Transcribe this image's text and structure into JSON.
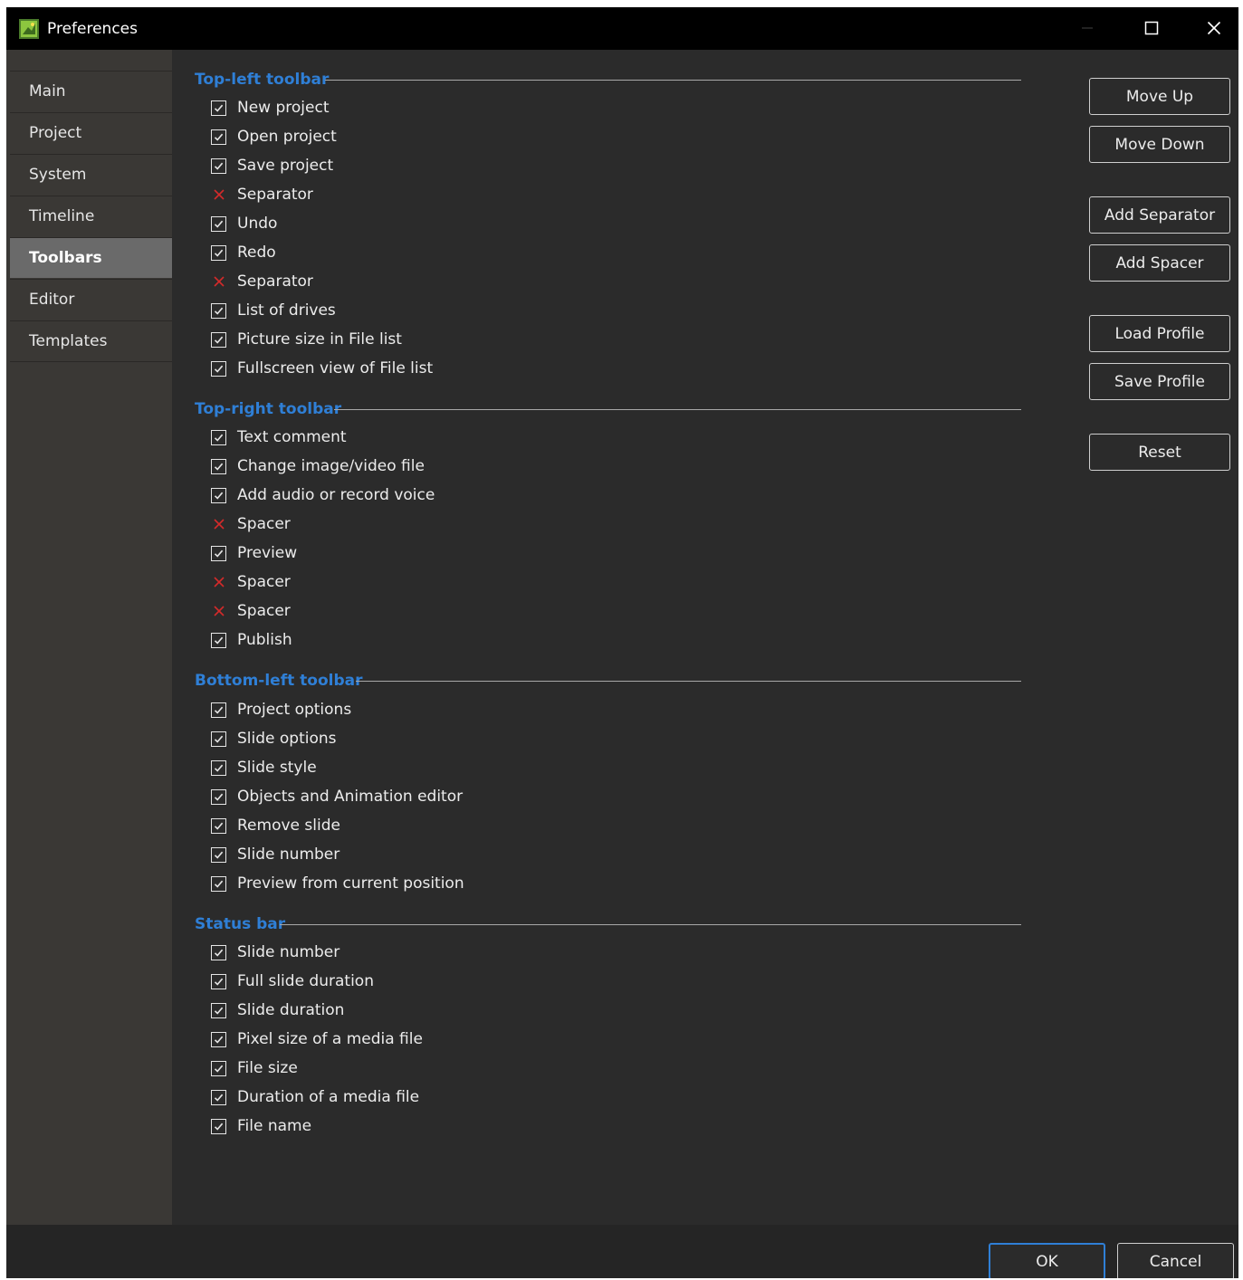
{
  "window": {
    "title": "Preferences",
    "accent_color": "#2f7fd6"
  },
  "sidebar": {
    "items": [
      {
        "label": "Main"
      },
      {
        "label": "Project"
      },
      {
        "label": "System"
      },
      {
        "label": "Timeline"
      },
      {
        "label": "Toolbars",
        "active": true
      },
      {
        "label": "Editor"
      },
      {
        "label": "Templates"
      }
    ]
  },
  "sections": [
    {
      "title": "Top-left toolbar",
      "items": [
        {
          "label": "New project",
          "state": "checked"
        },
        {
          "label": "Open project",
          "state": "checked"
        },
        {
          "label": "Save project",
          "state": "checked"
        },
        {
          "label": "Separator",
          "state": "x"
        },
        {
          "label": "Undo",
          "state": "checked"
        },
        {
          "label": "Redo",
          "state": "checked"
        },
        {
          "label": "Separator",
          "state": "x"
        },
        {
          "label": "List of drives",
          "state": "checked"
        },
        {
          "label": "Picture size in File list",
          "state": "checked"
        },
        {
          "label": "Fullscreen view of File list",
          "state": "checked"
        }
      ]
    },
    {
      "title": "Top-right toolbar",
      "items": [
        {
          "label": "Text comment",
          "state": "checked"
        },
        {
          "label": "Change image/video file",
          "state": "checked"
        },
        {
          "label": "Add audio or record voice",
          "state": "checked"
        },
        {
          "label": "Spacer",
          "state": "x"
        },
        {
          "label": "Preview",
          "state": "checked"
        },
        {
          "label": "Spacer",
          "state": "x"
        },
        {
          "label": "Spacer",
          "state": "x"
        },
        {
          "label": "Publish",
          "state": "checked"
        }
      ]
    },
    {
      "title": "Bottom-left toolbar",
      "items": [
        {
          "label": "Project options",
          "state": "checked"
        },
        {
          "label": "Slide options",
          "state": "checked"
        },
        {
          "label": "Slide style",
          "state": "checked"
        },
        {
          "label": "Objects and Animation editor",
          "state": "checked"
        },
        {
          "label": "Remove slide",
          "state": "checked"
        },
        {
          "label": "Slide number",
          "state": "checked"
        },
        {
          "label": "Preview from current position",
          "state": "checked"
        }
      ]
    },
    {
      "title": "Status bar",
      "items": [
        {
          "label": "Slide number",
          "state": "checked"
        },
        {
          "label": "Full slide duration",
          "state": "checked"
        },
        {
          "label": "Slide duration",
          "state": "checked"
        },
        {
          "label": "Pixel size of a media file",
          "state": "checked"
        },
        {
          "label": "File size",
          "state": "checked"
        },
        {
          "label": "Duration of a media file",
          "state": "checked"
        },
        {
          "label": "File name",
          "state": "checked"
        }
      ]
    }
  ],
  "actions": {
    "move_up": "Move Up",
    "move_down": "Move Down",
    "add_separator": "Add Separator",
    "add_spacer": "Add Spacer",
    "load_profile": "Load Profile",
    "save_profile": "Save Profile",
    "reset": "Reset"
  },
  "footer": {
    "ok": "OK",
    "cancel": "Cancel"
  }
}
